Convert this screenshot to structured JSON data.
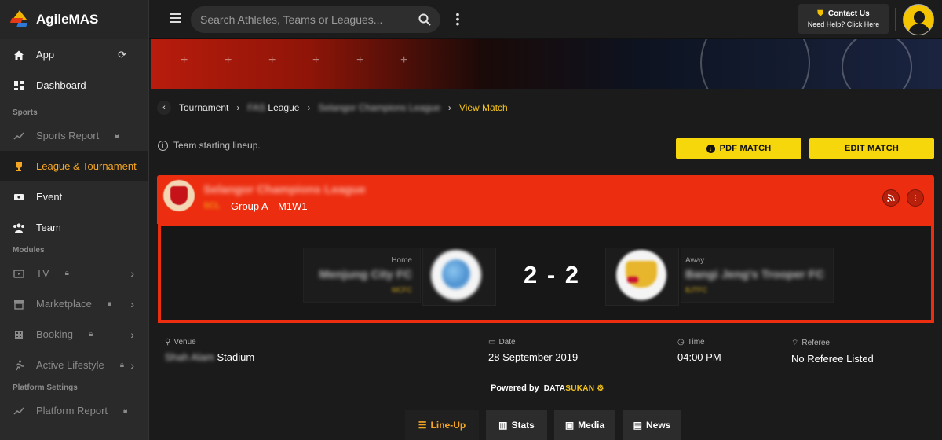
{
  "app": {
    "name": "AgileMAS"
  },
  "sidebar": {
    "items": [
      {
        "label": "App",
        "icon": "home-icon"
      },
      {
        "label": "Dashboard",
        "icon": "dashboard-icon"
      }
    ],
    "section_sports": "Sports",
    "sports": [
      {
        "label": "Sports Report",
        "icon": "trending-icon",
        "locked": true
      },
      {
        "label": "League & Tournament",
        "icon": "trophy-icon",
        "active": true
      },
      {
        "label": "Event",
        "icon": "ticket-icon"
      },
      {
        "label": "Team",
        "icon": "team-icon"
      }
    ],
    "section_modules": "Modules",
    "modules": [
      {
        "label": "TV",
        "icon": "tv-icon",
        "locked": true
      },
      {
        "label": "Marketplace",
        "icon": "store-icon",
        "locked": true
      },
      {
        "label": "Booking",
        "icon": "building-icon",
        "locked": true
      },
      {
        "label": "Active Lifestyle",
        "icon": "run-icon",
        "locked": true
      }
    ],
    "section_platform": "Platform Settings",
    "platform": [
      {
        "label": "Platform Report",
        "icon": "trending-icon",
        "locked": true
      }
    ]
  },
  "topbar": {
    "search_placeholder": "Search Athletes, Teams or Leagues...",
    "contact_title": "Contact Us",
    "contact_sub": "Need Help? Click Here"
  },
  "breadcrumb": {
    "items": [
      "Tournament",
      "FAS League",
      "Selangor Champions League"
    ],
    "current": "View Match",
    "league_suffix": "League",
    "league_prefix_blur": "FAS"
  },
  "info_text": "Team starting lineup.",
  "buttons": {
    "pdf": "PDF MATCH",
    "edit": "EDIT MATCH"
  },
  "match": {
    "league_name": "Selangor Champions League",
    "league_abbr": "SCL",
    "group": "Group A",
    "code": "M1W1",
    "home_label": "Home",
    "home_team": "Menjung City FC",
    "home_abbr": "MCFC",
    "away_label": "Away",
    "away_team": "Bangi Jeng's Trooper FC",
    "away_abbr": "BJTFC",
    "score": "2 - 2"
  },
  "details": {
    "venue_label": "Venue",
    "venue_blur": "Shah Alam",
    "venue_value": "Stadium",
    "date_label": "Date",
    "date_value": "28 September 2019",
    "time_label": "Time",
    "time_value": "04:00 PM",
    "referee_label": "Referee",
    "referee_value": "No Referee Listed"
  },
  "powered": {
    "label": "Powered by",
    "brand_a": "DATA",
    "brand_b": "SUKAN"
  },
  "tabs": [
    "Line-Up",
    "Stats",
    "Media",
    "News"
  ],
  "colors": {
    "accent_red": "#ec2d10",
    "accent_yellow": "#f6d70c",
    "active_orange": "#f5a623"
  }
}
